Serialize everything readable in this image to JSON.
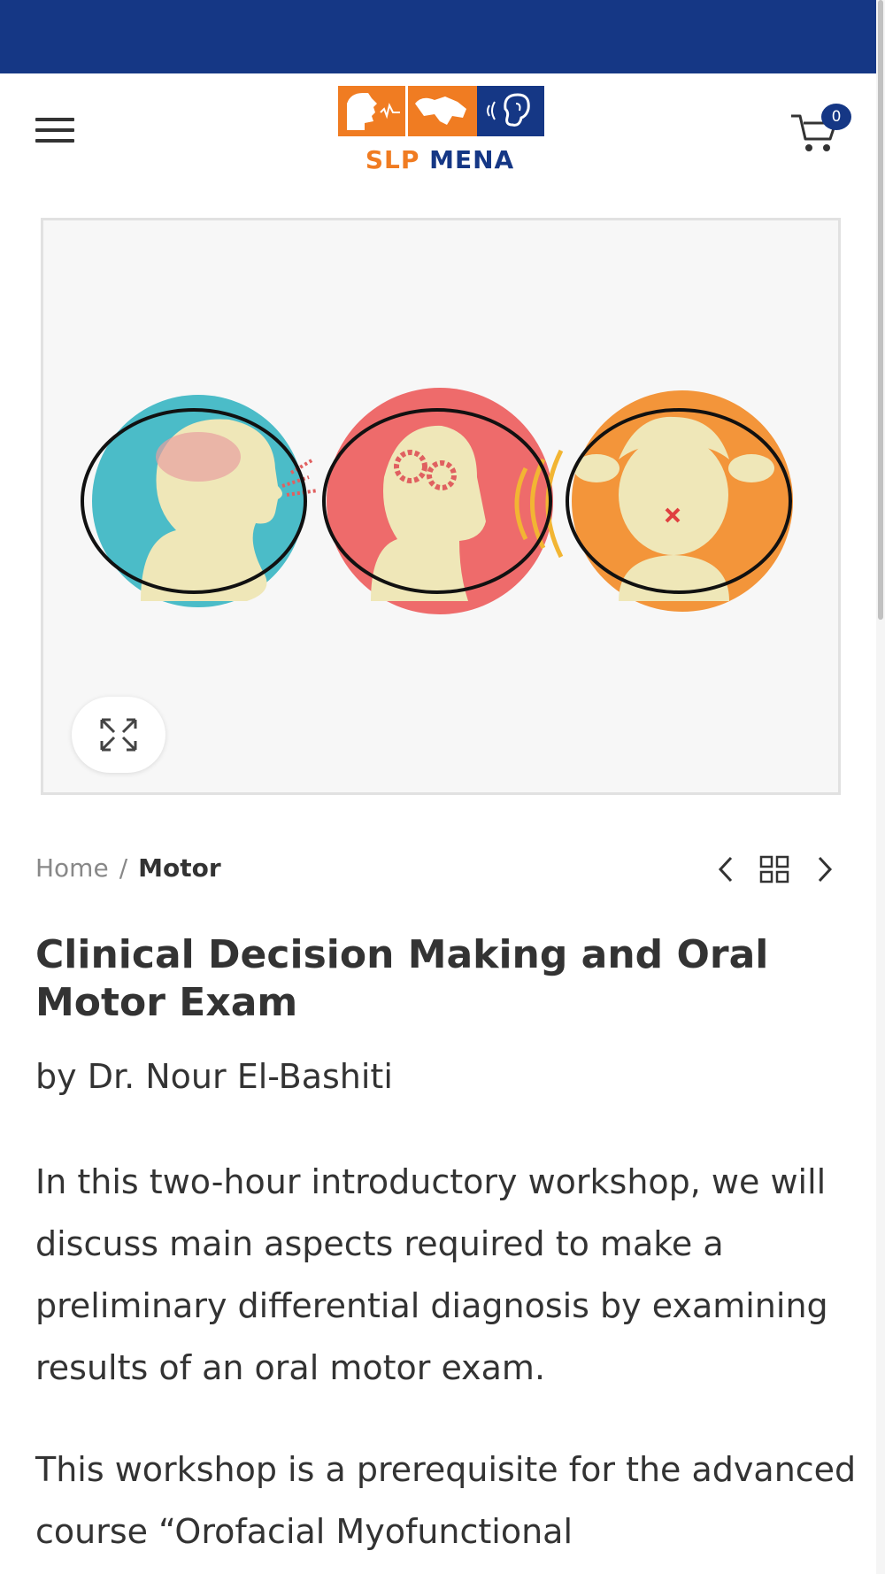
{
  "header": {
    "menu_icon": "hamburger-menu-icon",
    "logo": {
      "slp": "SLP",
      "mena": "MENA"
    },
    "cart": {
      "icon": "cart-icon",
      "count": "0"
    }
  },
  "gallery": {
    "image_description_icons": [
      "speech-head-icon",
      "hearing-head-icon",
      "child-mute-icon"
    ],
    "zoom_icon": "expand-icon"
  },
  "breadcrumb": {
    "home": "Home",
    "separator": "/",
    "current": "Motor"
  },
  "product_nav": {
    "prev_icon": "chevron-left-icon",
    "grid_icon": "grid-icon",
    "next_icon": "chevron-right-icon"
  },
  "product": {
    "title": "Clinical Decision Making and Oral Motor Exam",
    "byline": "by Dr. Nour El-Bashiti",
    "description_p1": "In this two-hour introductory workshop, we will discuss main aspects required to make a preliminary differential diagnosis by examining results of an oral motor exam.",
    "description_p2": "This workshop is a prerequisite for the advanced course “Orofacial Myofunctional"
  },
  "colors": {
    "brand_blue": "#153785",
    "brand_orange": "#f07c22"
  }
}
